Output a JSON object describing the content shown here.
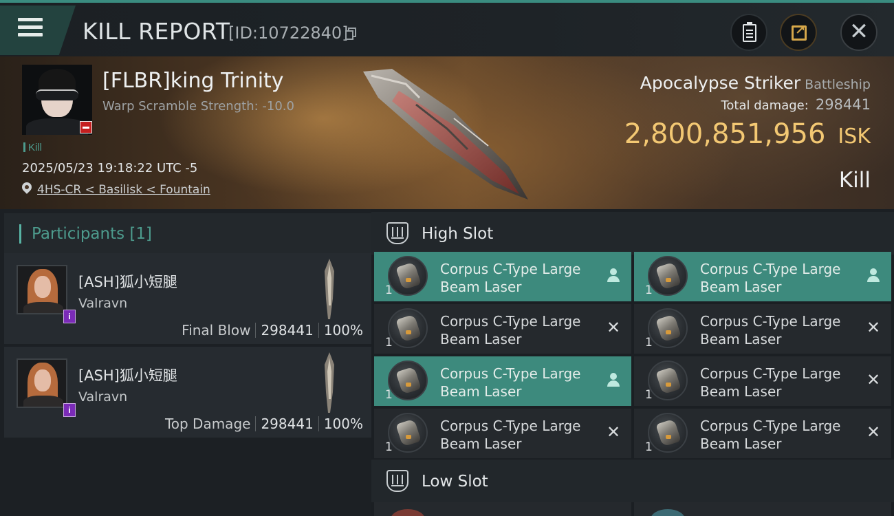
{
  "header": {
    "title": "KILL REPORT",
    "report_id": "[ID:10722840]",
    "icons": {
      "menu": "hamburger-menu-icon",
      "copy": "copy-icon",
      "clipboard": "clipboard-icon",
      "share": "share-external-icon",
      "close": "close-icon"
    }
  },
  "victim": {
    "name": "[FLBR]king Trinity",
    "warp_scramble": "Warp Scramble Strength: -10.0",
    "tag": "Kill",
    "timestamp": "2025/05/23 19:18:22 UTC -5",
    "location": "4HS-CR < Basilisk < Fountain",
    "ship_name": "Apocalypse Striker",
    "ship_class": "Battleship",
    "total_damage_label": "Total damage:",
    "total_damage": "298441",
    "isk_value": "2,800,851,956",
    "isk_unit": "ISK",
    "result": "Kill"
  },
  "participants": {
    "title": "Participants [1]",
    "rows": [
      {
        "name": "[ASH]狐小短腿",
        "ship": "Valravn",
        "role": "Final Blow",
        "damage": "298441",
        "percent": "100%",
        "badge": "i"
      },
      {
        "name": "[ASH]狐小短腿",
        "ship": "Valravn",
        "role": "Top Damage",
        "damage": "298441",
        "percent": "100%",
        "badge": "i"
      }
    ]
  },
  "fitting": {
    "high_slot_title": "High Slot",
    "low_slot_title": "Low Slot",
    "high_slot_modules": [
      {
        "name_line1": "Corpus C-Type Large",
        "name_line2": "Beam Laser",
        "qty": "1",
        "status": "dropped",
        "status_icon": "person-icon"
      },
      {
        "name_line1": "Corpus C-Type Large",
        "name_line2": "Beam Laser",
        "qty": "1",
        "status": "dropped",
        "status_icon": "person-icon"
      },
      {
        "name_line1": "Corpus C-Type Large",
        "name_line2": "Beam Laser",
        "qty": "1",
        "status": "destroyed",
        "status_icon": "x-icon",
        "status_glyph": "✕"
      },
      {
        "name_line1": "Corpus C-Type Large",
        "name_line2": "Beam Laser",
        "qty": "1",
        "status": "destroyed",
        "status_icon": "x-icon",
        "status_glyph": "✕"
      },
      {
        "name_line1": "Corpus C-Type Large",
        "name_line2": "Beam Laser",
        "qty": "1",
        "status": "dropped",
        "status_icon": "person-icon"
      },
      {
        "name_line1": "Corpus C-Type Large",
        "name_line2": "Beam Laser",
        "qty": "1",
        "status": "destroyed",
        "status_icon": "x-icon",
        "status_glyph": "✕"
      },
      {
        "name_line1": "Corpus C-Type Large",
        "name_line2": "Beam Laser",
        "qty": "1",
        "status": "destroyed",
        "status_icon": "x-icon",
        "status_glyph": "✕"
      },
      {
        "name_line1": "Corpus C-Type Large",
        "name_line2": "Beam Laser",
        "qty": "1",
        "status": "destroyed",
        "status_icon": "x-icon",
        "status_glyph": "✕"
      }
    ]
  },
  "colors": {
    "accent_teal": "#3d8a7d",
    "isk_gold": "#f3c873",
    "danger_red": "#c51f1f"
  }
}
